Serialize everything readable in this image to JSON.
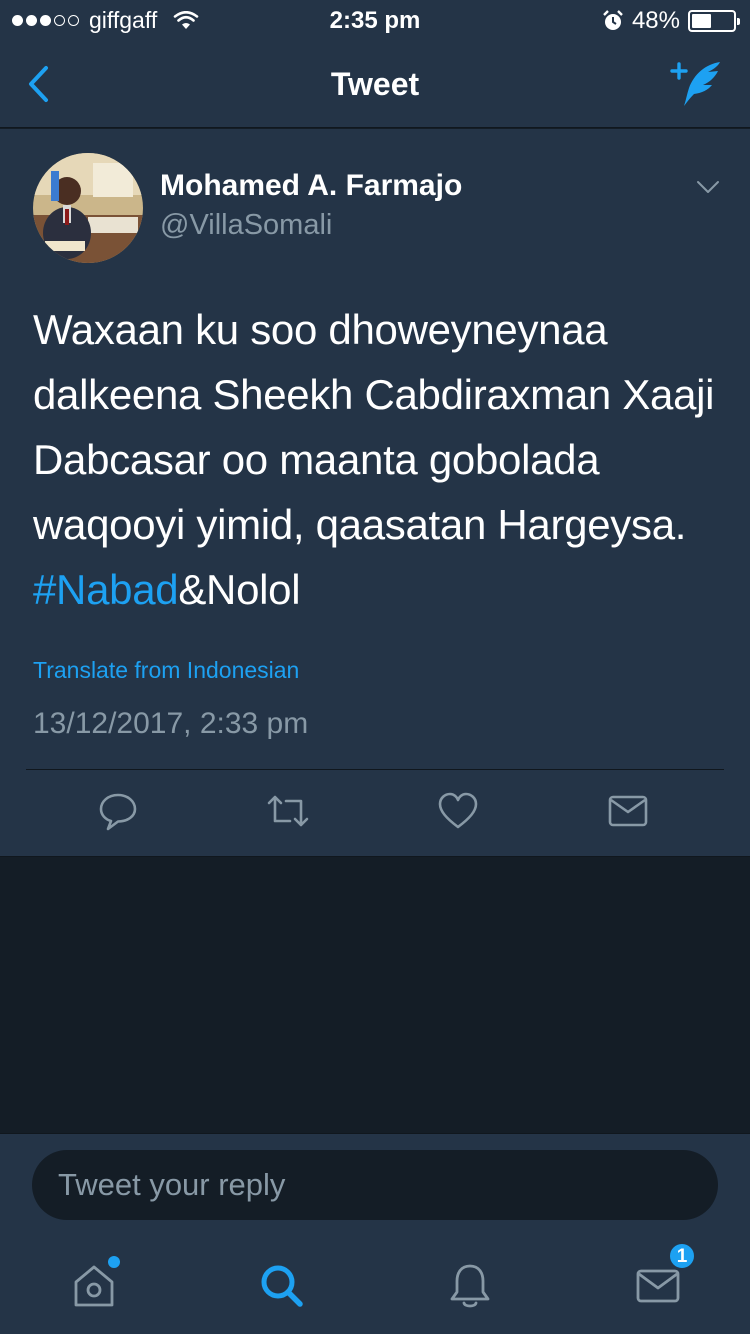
{
  "status_bar": {
    "carrier": "giffgaff",
    "signal_bars_filled": 3,
    "signal_bars_total": 5,
    "time": "2:35 pm",
    "battery": "48%",
    "battery_level": 0.48
  },
  "nav": {
    "title": "Tweet"
  },
  "tweet": {
    "author_name": "Mohamed A. Farmajo",
    "author_handle": "@VillaSomali",
    "text_before": "Waxaan ku soo dhoweyneynaa dalkeena Sheekh Cabdiraxman Xaaji Dabcasar oo maanta gobolada waqooyi yimid, qaasatan Hargeysa. ",
    "hashtag": "#Nabad",
    "text_after": "&Nolol",
    "translate_label": "Translate from Indonesian",
    "timestamp": "13/12/2017, 2:33 pm"
  },
  "reply": {
    "placeholder": "Tweet your reply"
  },
  "tab_bar": {
    "messages_badge": "1"
  },
  "colors": {
    "background": "#141d26",
    "panel": "#243447",
    "accent": "#1da1f2",
    "muted": "#8899a6"
  }
}
